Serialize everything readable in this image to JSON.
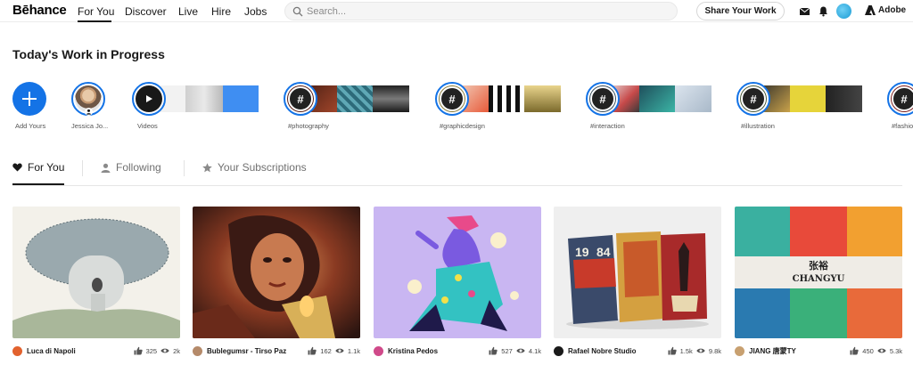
{
  "brand": "Bēhance",
  "nav": {
    "items": [
      "For You",
      "Discover",
      "Live",
      "Hire",
      "Jobs"
    ],
    "active": "For You"
  },
  "search": {
    "placeholder": "Search..."
  },
  "share_button": "Share Your Work",
  "adobe_label": "Adobe",
  "section_title": "Today's Work in Progress",
  "stories": [
    {
      "label": "Add Yours",
      "icon": "plus-icon"
    },
    {
      "label": "Jessica Jo..."
    },
    {
      "label": "Videos",
      "icon": "play-icon"
    },
    {
      "label": "#photography"
    },
    {
      "label": "#graphicdesign"
    },
    {
      "label": "#interaction"
    },
    {
      "label": "#illustration"
    },
    {
      "label": "#fashio"
    }
  ],
  "hash_symbol": "#",
  "tabs": [
    {
      "label": "For You",
      "icon": "heart-icon",
      "active": true
    },
    {
      "label": "Following",
      "icon": "user-icon",
      "active": false
    },
    {
      "label": "Your Subscriptions",
      "icon": "star-icon",
      "active": false
    }
  ],
  "projects": [
    {
      "owner": "Luca di Napoli",
      "likes": "325",
      "views": "2k"
    },
    {
      "owner": "Bublegumsr - Tirso Paz",
      "likes": "162",
      "views": "1.1k"
    },
    {
      "owner": "Kristina Pedos",
      "likes": "527",
      "views": "4.1k"
    },
    {
      "owner": "Rafael Nobre Studio",
      "likes": "1.5k",
      "views": "9.8k"
    },
    {
      "owner": "JIANG 唐蒙TY",
      "likes": "450",
      "views": "5.3k"
    }
  ],
  "artwork_text": {
    "book_covers": [
      "19",
      "84"
    ],
    "changyu_cn": "张裕",
    "changyu_en": "CHANGYU"
  },
  "colors": {
    "accent": "#1473e6",
    "text": "#191919",
    "muted": "#707070"
  }
}
